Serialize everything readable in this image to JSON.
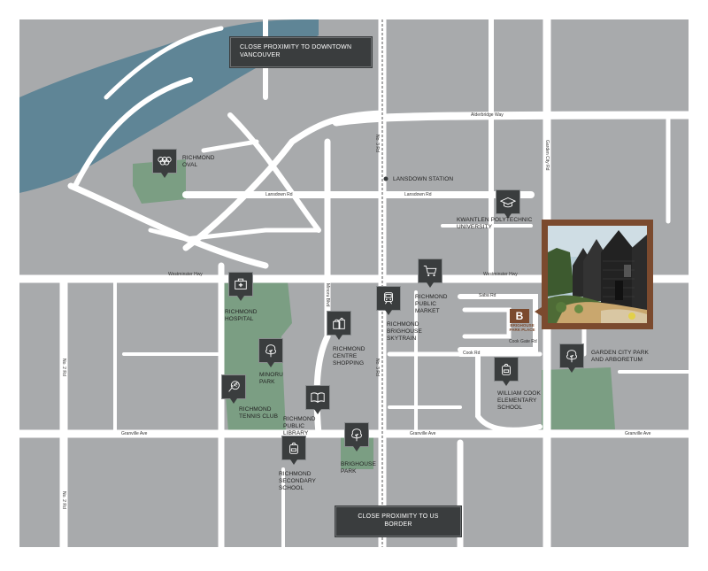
{
  "callouts": {
    "downtown": "CLOSE PROXIMITY TO DOWNTOWN VANCOUVER",
    "border": "CLOSE PROXIMITY TO US BORDER"
  },
  "roads": {
    "alderbridge": "Alderbridge Way",
    "lansdowne_left": "Lansdown Rd",
    "lansdowne_right": "Lansdown Rd",
    "westminster_left": "Westminster Hwy",
    "westminster_right": "Westminster Hwy",
    "granville_left": "Granville Ave",
    "granville_mid": "Granville Ave",
    "granville_right": "Granville Ave",
    "no3_top": "No. 3 Rd",
    "no3_mid": "No. 3 Rd",
    "no2_top": "No. 2 Rd",
    "no2_bottom": "No. 2 Rd",
    "minoru": "Minoru Blvd",
    "garden_city": "Garden City Rd",
    "saba": "Saba Rd",
    "cook": "Cook Rd",
    "cook_gate": "Cook Gate Rd"
  },
  "station": "LANSDOWN STATION",
  "pois": [
    {
      "id": "oval",
      "icon": "olympic-rings-icon",
      "label": "RICHMOND OVAL"
    },
    {
      "id": "kwantlen",
      "icon": "graduation-cap-icon",
      "label": "KWANTLEN POLYTECHNIC UNIVERSITY"
    },
    {
      "id": "hospital",
      "icon": "first-aid-kit-icon",
      "label": "RICHMOND HOSPITAL"
    },
    {
      "id": "market",
      "icon": "shopping-cart-icon",
      "label": "RICHMOND PUBLIC MARKET"
    },
    {
      "id": "skytrain",
      "icon": "train-icon",
      "label": "RICHMOND BRIGHOUSE SKYTRAIN"
    },
    {
      "id": "shopping",
      "icon": "shopping-bags-icon",
      "label": "RICHMOND CENTRE SHOPPING"
    },
    {
      "id": "minoru",
      "icon": "tree-icon",
      "label": "MINORU PARK"
    },
    {
      "id": "tennis",
      "icon": "tennis-racket-icon",
      "label": "RICHMOND TENNIS CLUB"
    },
    {
      "id": "library",
      "icon": "book-icon",
      "label": "RICHMOND PUBLIC LIBRARY"
    },
    {
      "id": "brighouse_park",
      "icon": "tree-icon",
      "label": "BRIGHOUSE PARK"
    },
    {
      "id": "secondary",
      "icon": "backpack-icon",
      "label": "RICHMOND SECONDARY SCHOOL"
    },
    {
      "id": "cook_school",
      "icon": "backpack-icon",
      "label": "WILLIAM COOK ELEMENTARY SCHOOL"
    },
    {
      "id": "garden_city",
      "icon": "tree-icon",
      "label": "GARDEN CITY PARK AND ARBORETUM"
    }
  ],
  "project": {
    "logo_letter": "B",
    "logo_text": "BRIGHOUSE PARK PLACE"
  },
  "colors": {
    "land": "#a8aaac",
    "road": "#ffffff",
    "river": "#5f8596",
    "park": "#7b9e83",
    "marker": "#3a3d3e",
    "accent": "#7b4a2e"
  }
}
